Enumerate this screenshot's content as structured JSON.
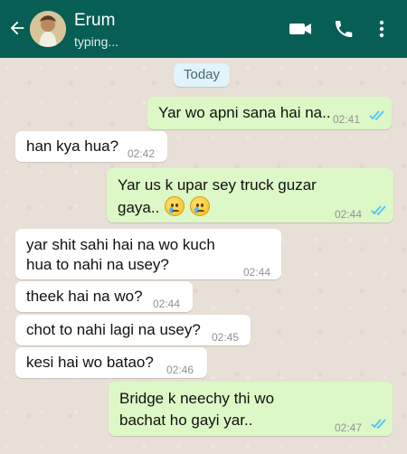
{
  "contact": {
    "name": "Erum",
    "status": "typing..."
  },
  "date_pill": "Today",
  "messages": [
    {
      "text": "Yar wo apni sana hai na..",
      "time": "02:41",
      "direction": "outgoing"
    },
    {
      "text": "han kya hua?",
      "time": "02:42",
      "direction": "incoming"
    },
    {
      "text": "Yar us k upar sey truck guzar gaya..",
      "line1": "Yar us k upar sey truck guzar",
      "line2": "gaya..",
      "time": "02:44",
      "direction": "outgoing"
    },
    {
      "line1": "yar shit sahi hai na wo kuch",
      "line2": "hua to nahi na usey?",
      "time": "02:44",
      "direction": "incoming"
    },
    {
      "text": "theek hai na wo?",
      "time": "02:44",
      "direction": "incoming"
    },
    {
      "text": "chot to nahi lagi na usey?",
      "time": "02:45",
      "direction": "incoming"
    },
    {
      "text": "kesi hai wo batao?",
      "time": "02:46",
      "direction": "incoming"
    },
    {
      "line1": "Bridge k neechy thi wo",
      "line2": "bachat ho gayi yar..",
      "time": "02:47",
      "direction": "outgoing"
    }
  ],
  "icons": {
    "back": "back-arrow-icon",
    "video": "video-call-icon",
    "call": "phone-icon",
    "more": "more-vertical-icon",
    "read": "double-check-icon",
    "emoji": "crying-face-emoji"
  },
  "colors": {
    "header": "#075e54",
    "outgoing_bubble": "#dcf8c6",
    "incoming_bubble": "#ffffff",
    "read_tick": "#4fc3f7"
  }
}
